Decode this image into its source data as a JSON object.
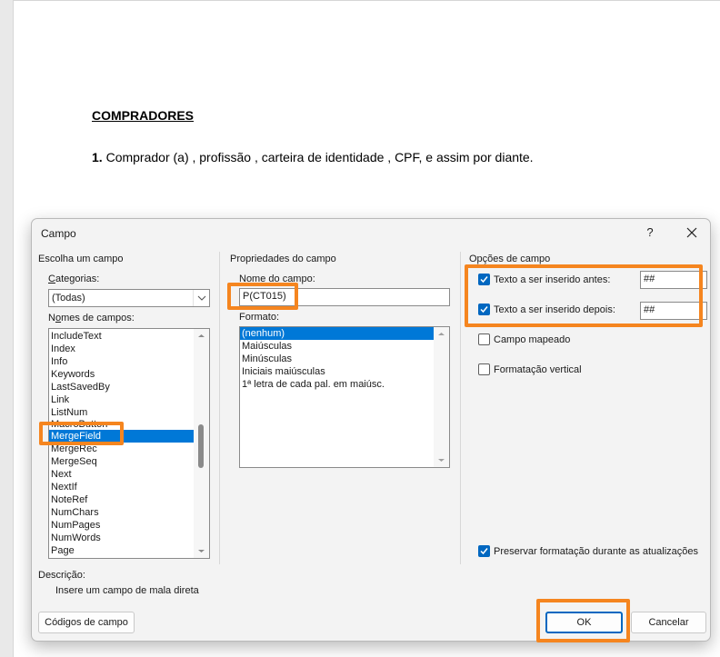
{
  "document": {
    "heading": "COMPRADORES",
    "paragraph_number": "1.",
    "paragraph_text": " Comprador (a) , profissão , carteira de identidade , CPF, e assim por diante."
  },
  "dialog": {
    "title": "Campo",
    "help_label": "?",
    "choose_field": {
      "group_title": "Escolha um campo",
      "categories_label": "Categorias:",
      "categories_value": "(Todas)",
      "field_names_label": "Nomes de campos:",
      "field_names": [
        "IncludeText",
        "Index",
        "Info",
        "Keywords",
        "LastSavedBy",
        "Link",
        "ListNum",
        "MacroButton",
        "MergeField",
        "MergeRec",
        "MergeSeq",
        "Next",
        "NextIf",
        "NoteRef",
        "NumChars",
        "NumPages",
        "NumWords",
        "Page"
      ],
      "selected_field": "MergeField"
    },
    "field_properties": {
      "group_title": "Propriedades do campo",
      "field_name_label": "Nome do campo:",
      "field_name_value": "P(CT015)",
      "format_label": "Formato:",
      "formats": [
        "(nenhum)",
        "Maiúsculas",
        "Minúsculas",
        "Iniciais maiúsculas",
        "1ª letra de cada pal. em maiúsc."
      ],
      "selected_format": "(nenhum)"
    },
    "field_options": {
      "group_title": "Opções de campo",
      "before_label": "Texto a ser inserido antes:",
      "before_checked": true,
      "before_value": "##",
      "after_label": "Texto a ser inserido depois:",
      "after_checked": true,
      "after_value": "##",
      "mapped_label": "Campo mapeado",
      "mapped_checked": false,
      "vertical_label": "Formatação vertical",
      "vertical_checked": false,
      "preserve_label": "Preservar formatação durante as atualizações",
      "preserve_checked": true
    },
    "description_label": "Descrição:",
    "description_text": "Insere um campo de mala direta",
    "field_codes_button": "Códigos de campo",
    "ok_button": "OK",
    "cancel_button": "Cancelar"
  },
  "colors": {
    "highlight": "#f5851f",
    "selection": "#0078d7",
    "checkbox_checked": "#0067c0"
  }
}
